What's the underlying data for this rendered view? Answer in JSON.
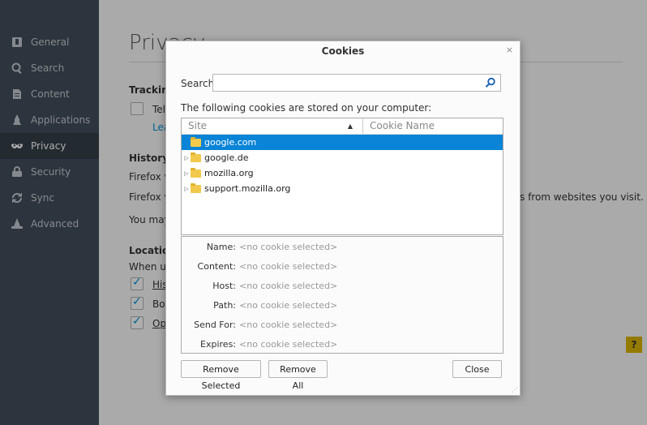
{
  "sidebar": {
    "items": [
      {
        "label": "General",
        "icon": "general-icon"
      },
      {
        "label": "Search",
        "icon": "search-icon"
      },
      {
        "label": "Content",
        "icon": "document-icon"
      },
      {
        "label": "Applications",
        "icon": "rocket-icon"
      },
      {
        "label": "Privacy",
        "icon": "mask-icon",
        "active": true
      },
      {
        "label": "Security",
        "icon": "lock-icon"
      },
      {
        "label": "Sync",
        "icon": "sync-icon"
      },
      {
        "label": "Advanced",
        "icon": "wizard-hat-icon"
      }
    ]
  },
  "page": {
    "title": "Privacy",
    "tracking_heading": "Trackin",
    "tracking_option": "Tel",
    "tracking_link": "Lea",
    "history_heading": "History",
    "history_line1": "Firefox w",
    "history_line2": "Firefox w",
    "history_line2_right": "s from websites you visit.",
    "history_line3": "You may",
    "location_heading": "Locatio",
    "location_line": "When us",
    "location_items": [
      {
        "label": "His",
        "checked": true
      },
      {
        "label": "Boo",
        "checked": true
      },
      {
        "label": "Op",
        "checked": true
      }
    ],
    "help_label": "?"
  },
  "dialog": {
    "title": "Cookies",
    "close_label": "×",
    "search_label": "Search:",
    "search_value": "",
    "search_placeholder": "",
    "stored_label": "The following cookies are stored on your computer:",
    "columns": {
      "site": "Site",
      "name": "Cookie Name"
    },
    "sites": [
      {
        "name": "google.com",
        "selected": true
      },
      {
        "name": "google.de",
        "selected": false
      },
      {
        "name": "mozilla.org",
        "selected": false
      },
      {
        "name": "support.mozilla.org",
        "selected": false
      }
    ],
    "details": [
      {
        "key": "Name:",
        "value": "<no cookie selected>"
      },
      {
        "key": "Content:",
        "value": "<no cookie selected>"
      },
      {
        "key": "Host:",
        "value": "<no cookie selected>"
      },
      {
        "key": "Path:",
        "value": "<no cookie selected>"
      },
      {
        "key": "Send For:",
        "value": "<no cookie selected>"
      },
      {
        "key": "Expires:",
        "value": "<no cookie selected>"
      }
    ],
    "buttons": {
      "remove_selected": "Remove Selected",
      "remove_all": "Remove All",
      "close": "Close"
    }
  },
  "colors": {
    "sidebar_bg": "#424f5a",
    "accent": "#0a84d6",
    "help_bg": "#dcb400"
  }
}
